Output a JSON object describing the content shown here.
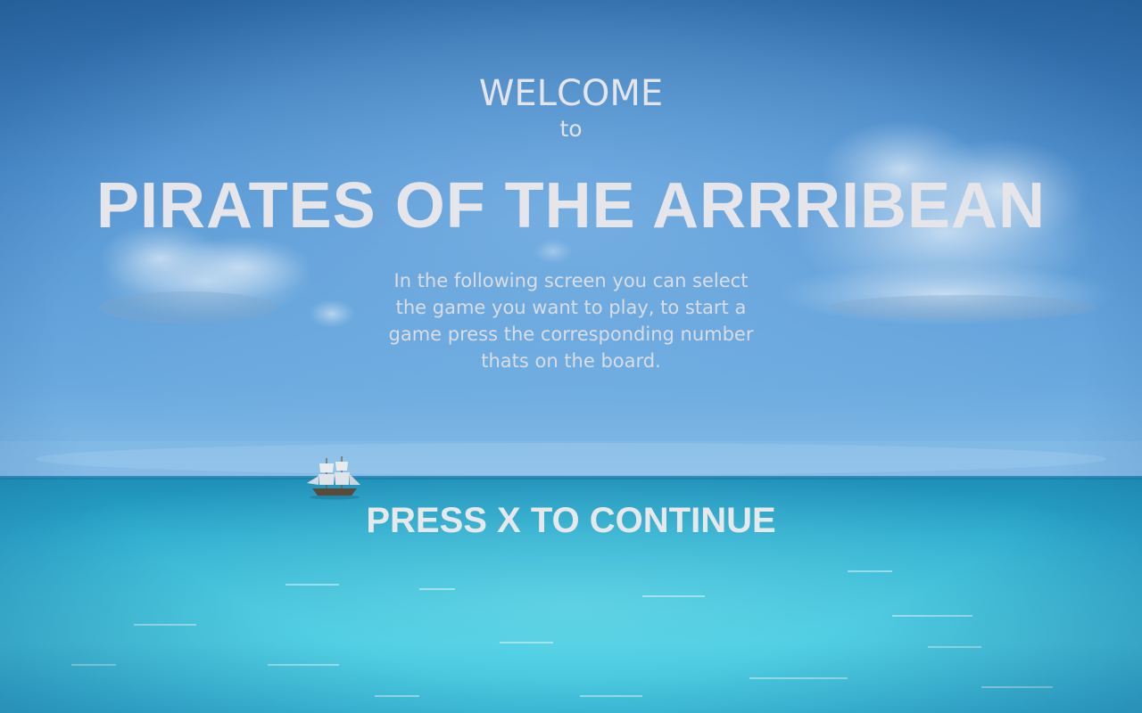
{
  "screen": {
    "welcome": "WELCOME",
    "to": "to",
    "title": "PIRATES OF THE ARRRIBEAN",
    "description": "In the following screen you can select the game you want to play, to start a game press the corresponding number thats on the board.",
    "continue_prompt": "PRESS X TO CONTINUE"
  },
  "colors": {
    "sky_top": "#2f6fae",
    "sky_mid": "#5b9ad6",
    "horizon": "#7fb9e6",
    "sea_top": "#27a4c7",
    "sea_bottom": "#3fcbe0",
    "text": "#e4e6ea"
  },
  "icons": [
    "ship-icon",
    "cloud-icon"
  ]
}
